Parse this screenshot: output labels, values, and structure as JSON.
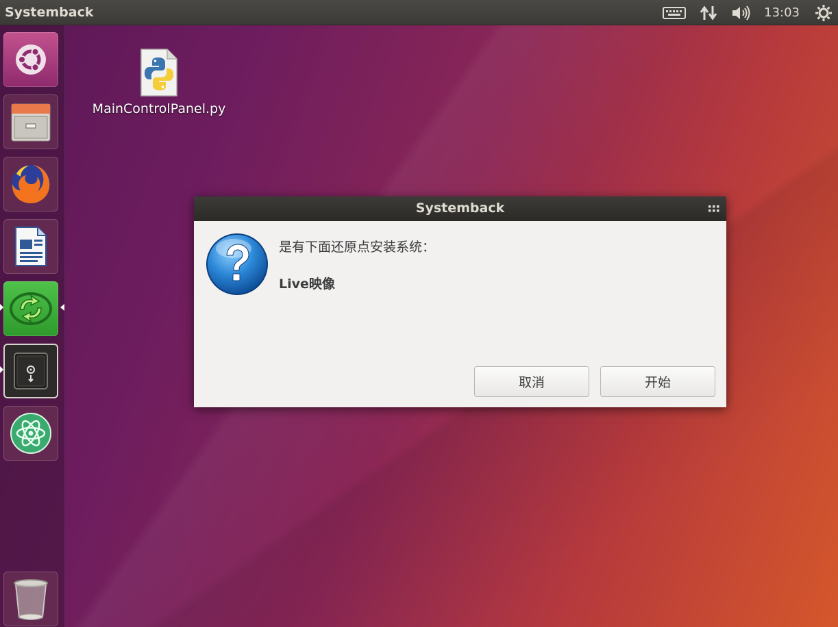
{
  "top_panel": {
    "app_title": "Systemback",
    "clock": "13:03",
    "indicators": [
      "keyboard-icon",
      "network-icon",
      "volume-icon",
      "power-gear-icon"
    ]
  },
  "launcher": {
    "items": [
      {
        "name": "ubuntu-dash",
        "icon": "ubuntu-logo-icon"
      },
      {
        "name": "files",
        "icon": "file-cabinet-icon"
      },
      {
        "name": "firefox",
        "icon": "firefox-icon"
      },
      {
        "name": "libreoffice-writer",
        "icon": "writer-document-icon"
      },
      {
        "name": "sync-app",
        "icon": "green-sync-icon"
      },
      {
        "name": "systemback",
        "icon": "safe-icon"
      },
      {
        "name": "atom",
        "icon": "atom-icon"
      },
      {
        "name": "trash",
        "icon": "trash-icon"
      }
    ]
  },
  "desktop": {
    "file_label": "MainControlPanel.py",
    "file_icon": "python-file-icon"
  },
  "dialog": {
    "title": "Systemback",
    "message": "是有下面还原点安装系统：",
    "detail": "Live映像",
    "icon": "question-icon",
    "buttons": {
      "cancel": "取消",
      "start": "开始"
    }
  },
  "colors": {
    "accent_orange": "#e95420",
    "panel_bg": "#3c3b37",
    "dialog_bg": "#f2f1f0"
  }
}
